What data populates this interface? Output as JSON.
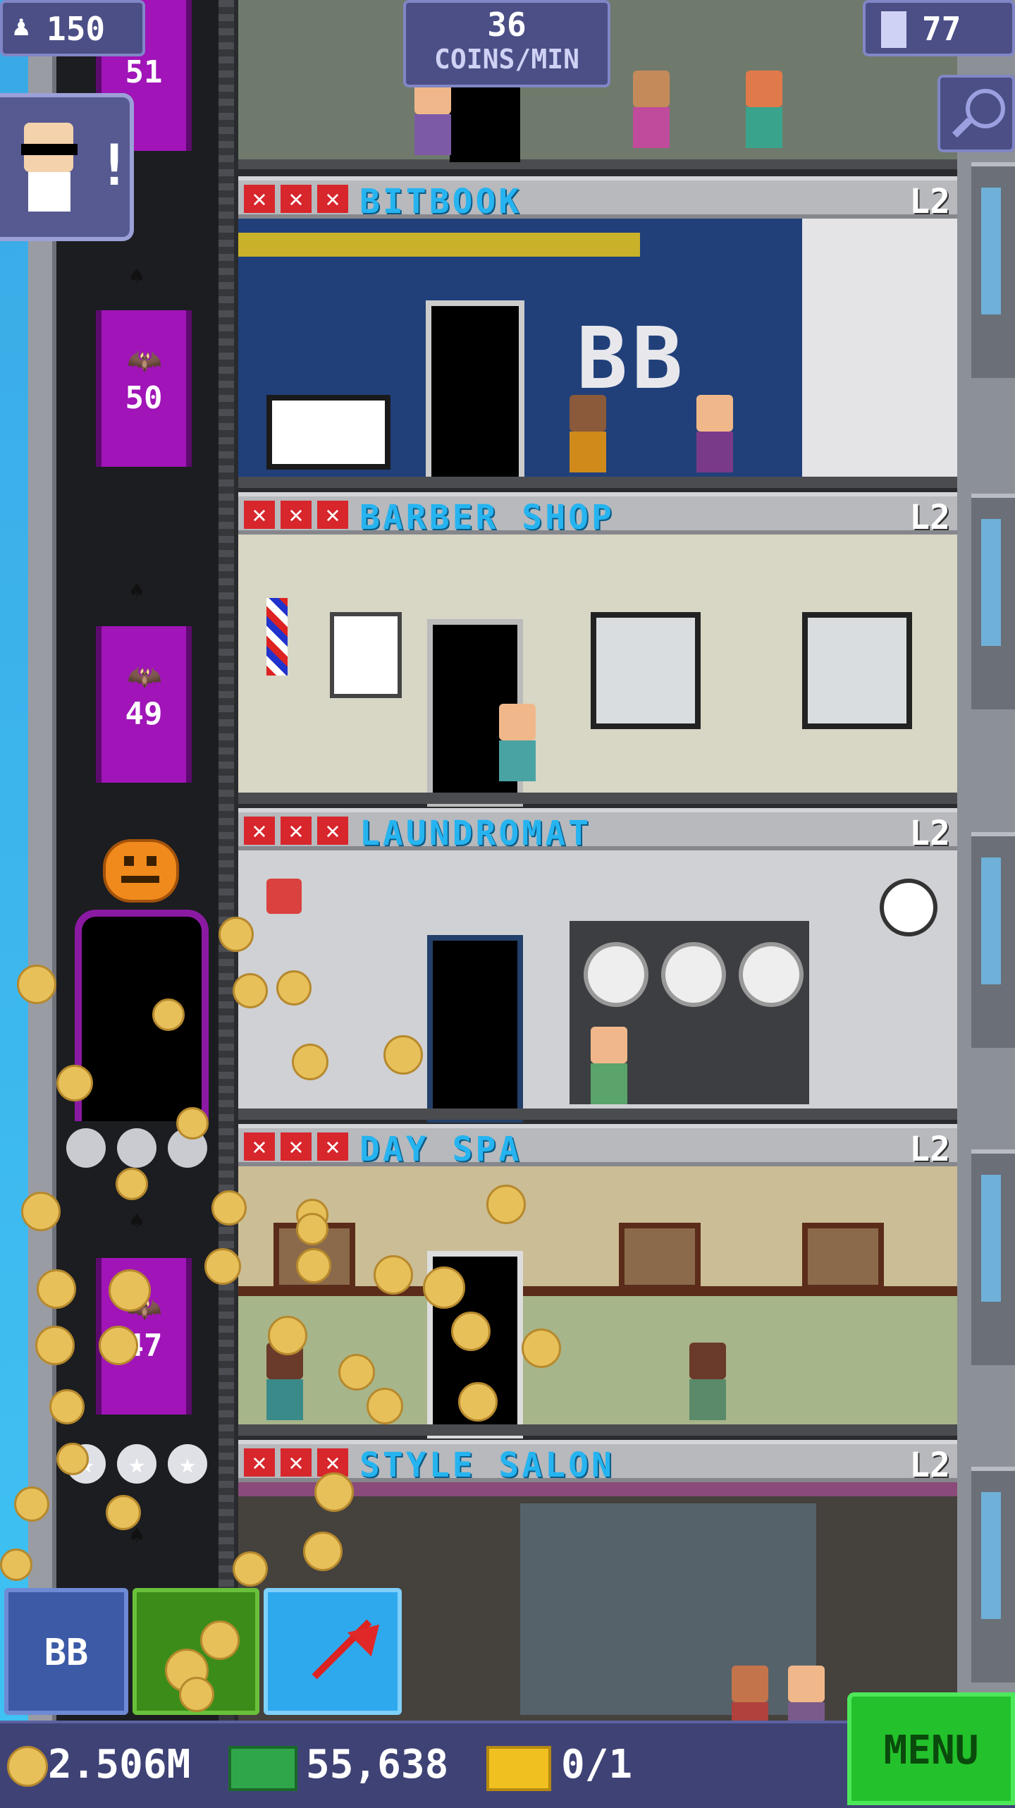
{
  "hud": {
    "population": "150",
    "coins_rate_value": "36",
    "coins_rate_unit": "COINS/MIN",
    "floors_count": "77"
  },
  "elevator": {
    "floor_numbers": [
      "51",
      "50",
      "49",
      "47"
    ]
  },
  "floors": [
    {
      "name": "BITBOOK",
      "level": "L2",
      "letters": "BB"
    },
    {
      "name": "BARBER SHOP",
      "level": "L2"
    },
    {
      "name": "LAUNDROMAT",
      "level": "L2"
    },
    {
      "name": "DAY SPA",
      "level": "L2"
    },
    {
      "name": "STYLE SALON",
      "level": "L2"
    }
  ],
  "bottom_buttons": {
    "bitbook_label": "BB"
  },
  "status_bar": {
    "coins": "2.506M",
    "bux": "55,638",
    "tickets": "0/1",
    "menu_label": "MENU"
  },
  "colors": {
    "elevator_purple": "#a014b8",
    "floor_name_blue": "#26b4f0",
    "menu_green": "#23c12b",
    "hud_purple": "#4c4f86"
  }
}
